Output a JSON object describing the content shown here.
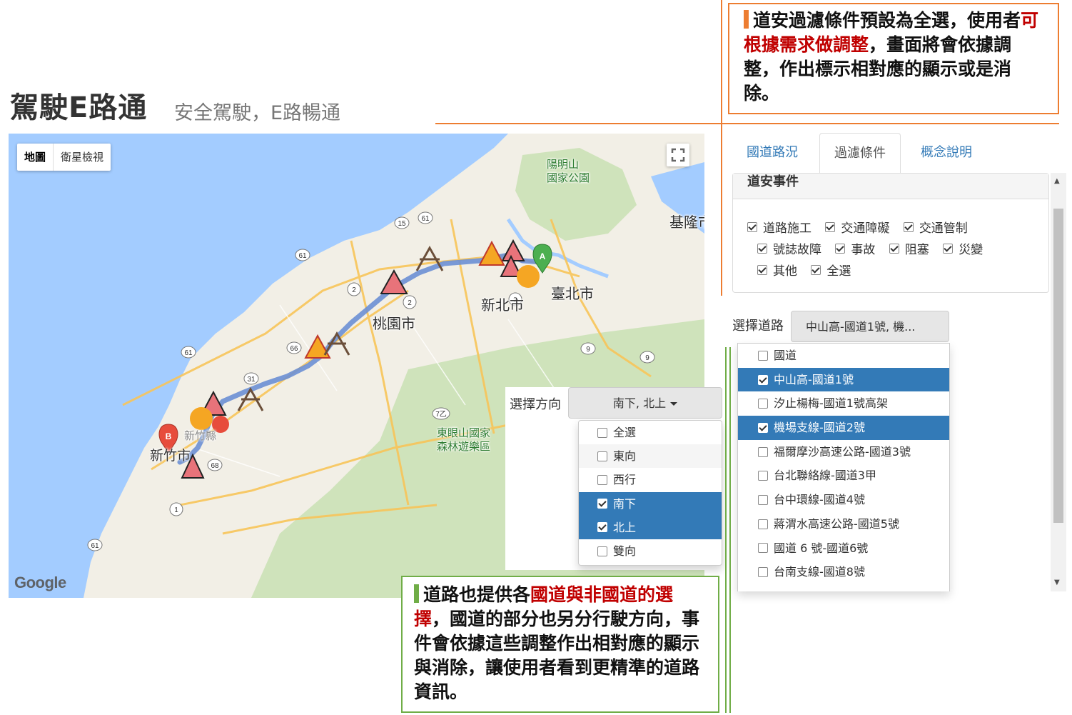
{
  "header": {
    "title": "駕駛E路通",
    "subtitle": "安全駕駛，E路暢通"
  },
  "callouts": {
    "top": {
      "text_before": "道安過濾條件預設為全選，使用者",
      "highlight": "可根據需求做調整",
      "text_after": "，畫面將會依據調整，作出標示相對應的顯示或是消除。",
      "accent_color": "#ed7d31"
    },
    "bottom": {
      "text_before": "道路也提供各",
      "highlight": "國道與非國道的選擇",
      "text_after": "，國道的部分也另分行駛方向，事件會依據這些調整作出相對應的顯示與消除，讓使用者看到更精準的道路資訊。",
      "accent_color": "#70ad47"
    },
    "highlight_color": "#c00000"
  },
  "map": {
    "type_buttons": [
      "地圖",
      "衛星檢視"
    ],
    "labels": {
      "yangmingshan": "陽明山\n國家公園",
      "keelung": "基隆市",
      "taipei": "臺北市",
      "new_taipei": "新北市",
      "taoyuan": "桃園市",
      "hsinchu_county": "新竹縣",
      "hsinchu_city": "新竹市",
      "dongyanshan": "東眼山國家\n森林遊樂區"
    },
    "route_shields": [
      "15",
      "61",
      "61",
      "61",
      "66",
      "31",
      "2",
      "2",
      "3",
      "9",
      "9",
      "7乙",
      "68",
      "61",
      "1"
    ],
    "markers": {
      "start": "A",
      "end": "B"
    },
    "logo": "Google",
    "colors": {
      "water": "#a3ccff",
      "land": "#f2efe6",
      "forest": "#c8dfb1",
      "route": "#6c8fd4",
      "sea_blue": "#8ab4f8"
    }
  },
  "tabs": [
    {
      "label": "國道路況",
      "active": false
    },
    {
      "label": "過濾條件",
      "active": true
    },
    {
      "label": "概念說明",
      "active": false
    }
  ],
  "events": {
    "title": "道安事件",
    "rows": [
      [
        {
          "label": "道路施工",
          "checked": true
        },
        {
          "label": "交通障礙",
          "checked": true
        },
        {
          "label": "交通管制",
          "checked": true
        }
      ],
      [
        {
          "label": "號誌故障",
          "checked": true
        },
        {
          "label": "事故",
          "checked": true
        },
        {
          "label": "阻塞",
          "checked": true
        },
        {
          "label": "災變",
          "checked": true
        }
      ],
      [
        {
          "label": "其他",
          "checked": true
        },
        {
          "label": "全選",
          "checked": true
        }
      ]
    ]
  },
  "road": {
    "label": "選擇道路",
    "button_text": "中山高-國道1號, 機...",
    "options": [
      {
        "label": "國道",
        "checked": false
      },
      {
        "label": "中山高-國道1號",
        "checked": true
      },
      {
        "label": "汐止楊梅-國道1號高架",
        "checked": false
      },
      {
        "label": "機場支線-國道2號",
        "checked": true
      },
      {
        "label": "福爾摩沙高速公路-國道3號",
        "checked": false
      },
      {
        "label": "台北聯絡線-國道3甲",
        "checked": false
      },
      {
        "label": "台中環線-國道4號",
        "checked": false
      },
      {
        "label": "蔣渭水高速公路-國道5號",
        "checked": false
      },
      {
        "label": "國道 6 號-國道6號",
        "checked": false
      },
      {
        "label": "台南支線-國道8號",
        "checked": false
      }
    ]
  },
  "direction": {
    "label": "選擇方向",
    "button_text": "南下, 北上",
    "options": [
      {
        "label": "全選",
        "checked": false
      },
      {
        "label": "東向",
        "checked": false
      },
      {
        "label": "西行",
        "checked": false
      },
      {
        "label": "南下",
        "checked": true
      },
      {
        "label": "北上",
        "checked": true
      },
      {
        "label": "雙向",
        "checked": false
      }
    ]
  }
}
